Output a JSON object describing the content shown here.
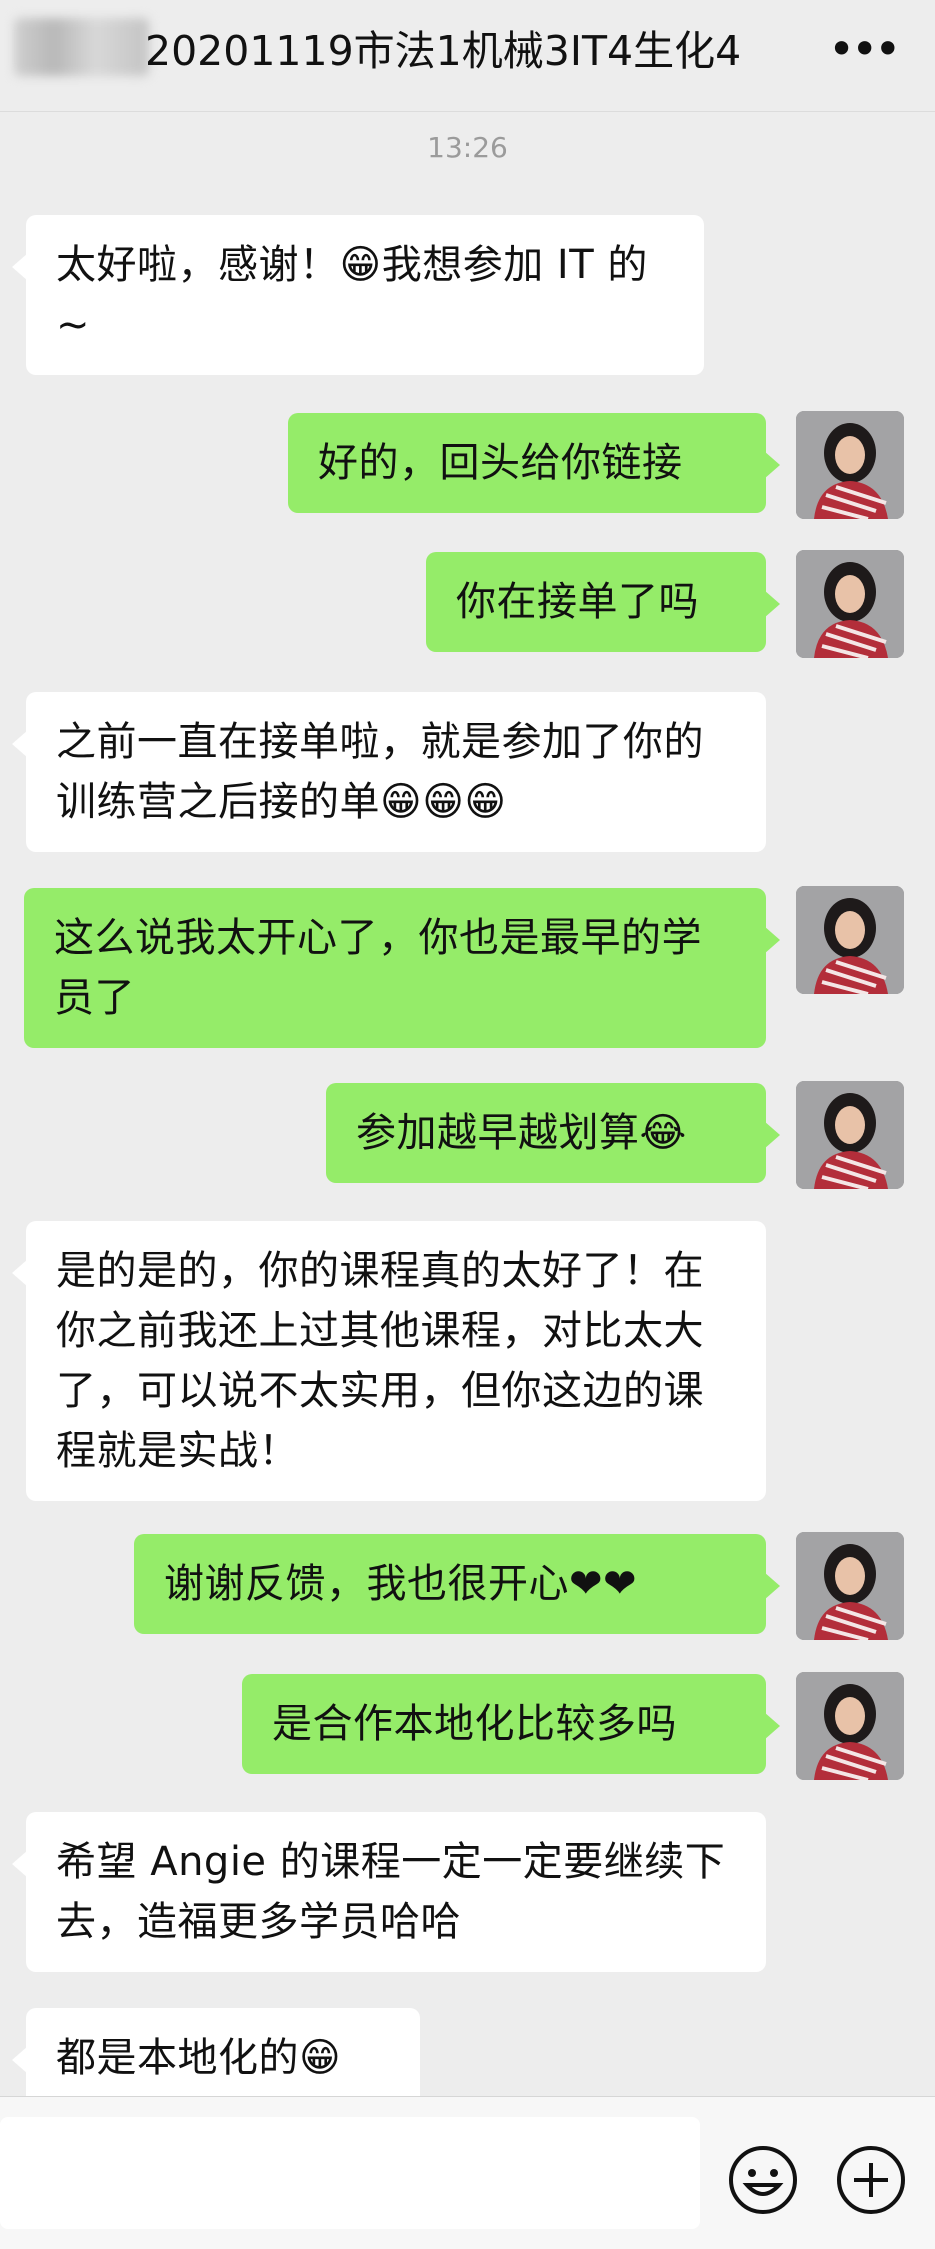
{
  "header": {
    "title": "20201119市法1机械3IT4生化4",
    "more_icon": "more-dots-icon"
  },
  "timestamp": "13:26",
  "messages": [
    {
      "side": "in",
      "text": "太好啦，感谢！😁我想参加 IT 的~"
    },
    {
      "side": "out",
      "text": "好的，回头给你链接"
    },
    {
      "side": "out",
      "text": "你在接单了吗"
    },
    {
      "side": "in",
      "text": "之前一直在接单啦，就是参加了你的训练营之后接的单😁😁😁"
    },
    {
      "side": "out",
      "text": "这么说我太开心了，你也是最早的学员了"
    },
    {
      "side": "out",
      "text": "参加越早越划算😂"
    },
    {
      "side": "in",
      "text": "是的是的，你的课程真的太好了！在你之前我还上过其他课程，对比太大了，可以说不太实用，但你这边的课程就是实战！"
    },
    {
      "side": "out",
      "text": "谢谢反馈，我也很开心❤❤"
    },
    {
      "side": "out",
      "text": "是合作本地化比较多吗"
    },
    {
      "side": "in",
      "text": "希望 Angie 的课程一定一定要继续下去，造福更多学员哈哈"
    },
    {
      "side": "in",
      "text": "都是本地化的😁"
    }
  ],
  "input": {
    "emoji_icon": "smiley-face-icon",
    "plus_icon": "plus-circle-icon"
  },
  "colors": {
    "background": "#ededed",
    "incoming_bubble": "#ffffff",
    "outgoing_bubble": "#95ec69"
  }
}
